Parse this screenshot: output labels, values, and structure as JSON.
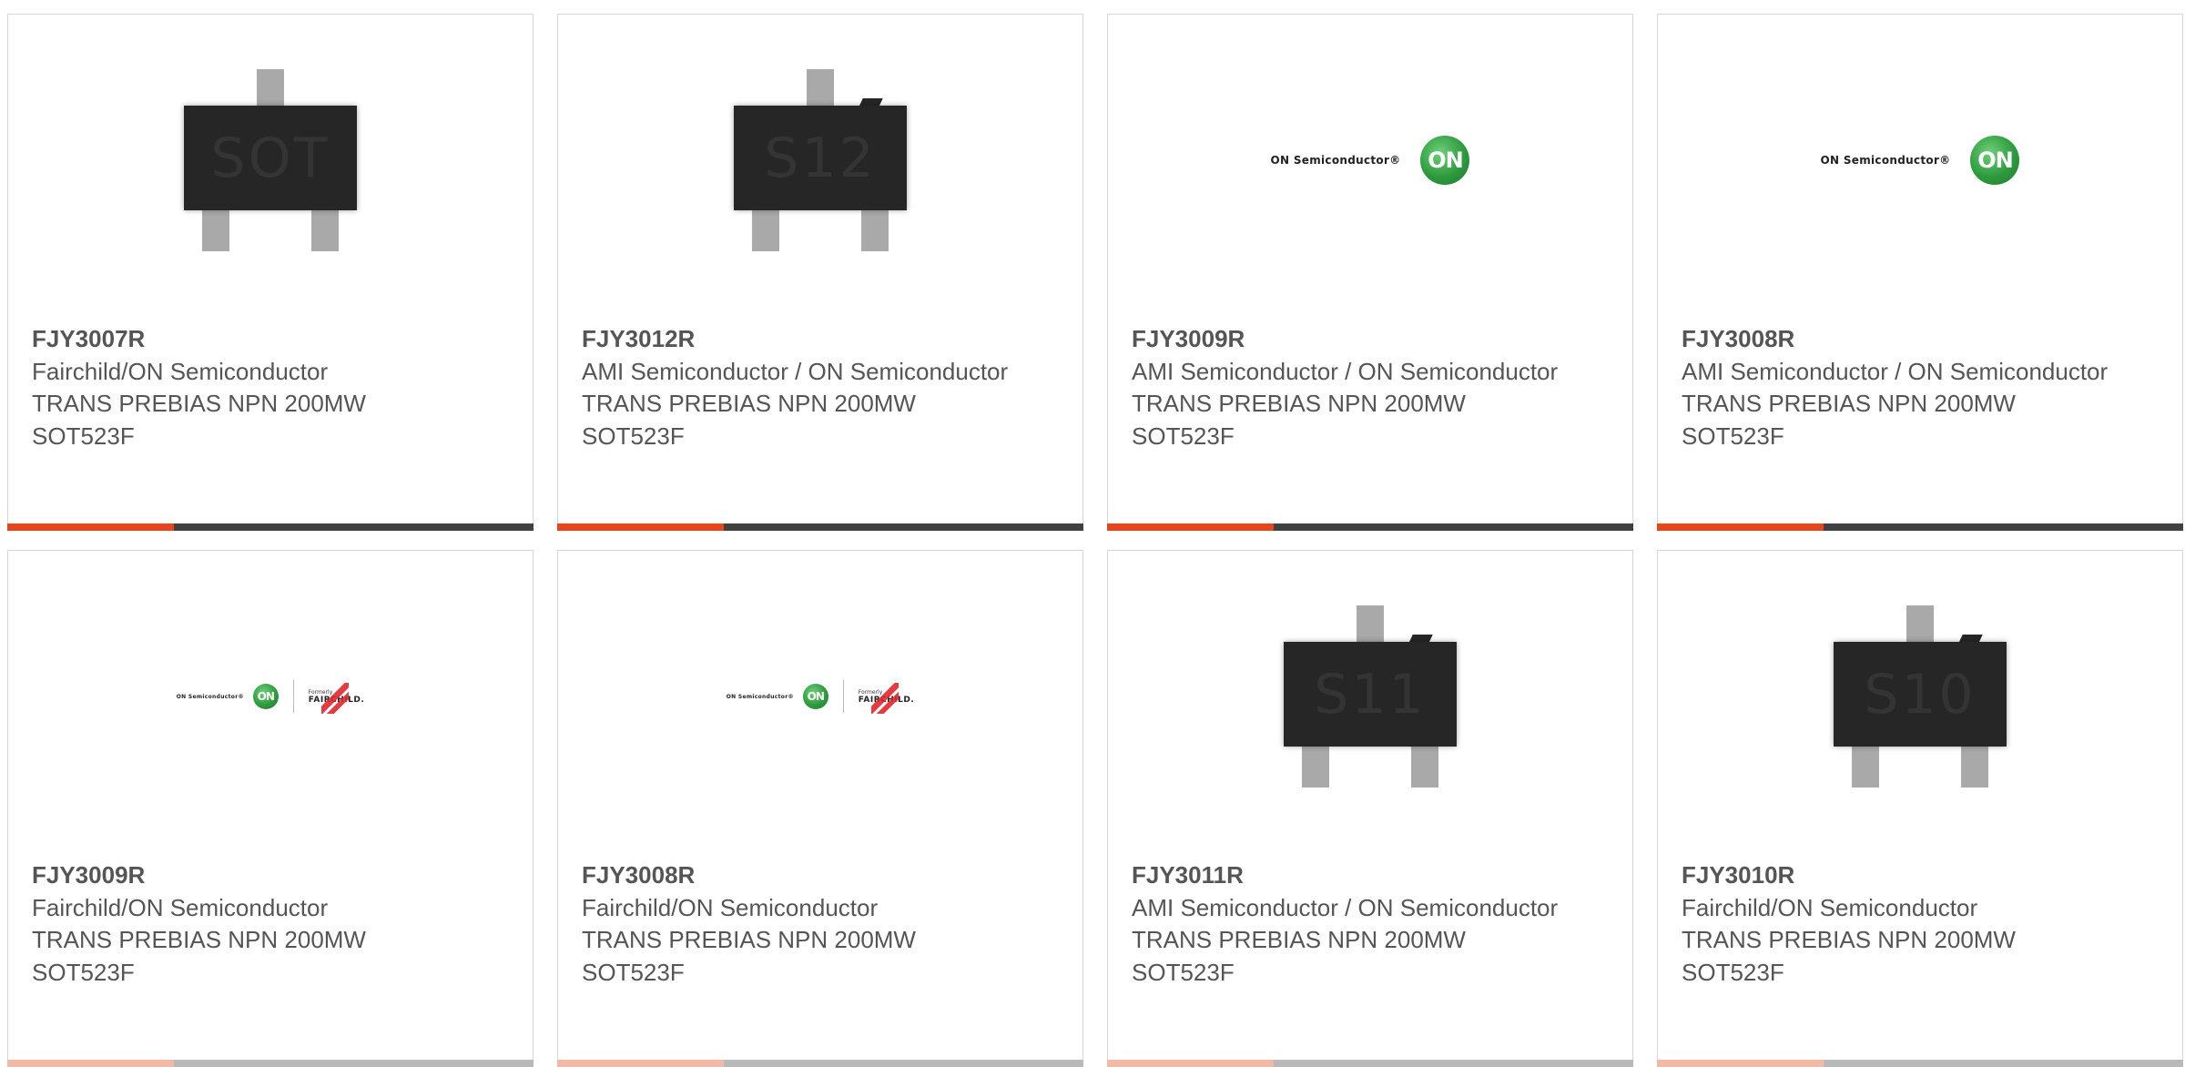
{
  "colors": {
    "accent_bar": "#e8451d",
    "dark_bar": "#404040",
    "accent_bar_faded": "#f1b9a6",
    "dark_bar_faded": "#b9b9b9"
  },
  "cards": [
    {
      "image_type": "chip",
      "chip_marking": "SOT",
      "part_number": "FJY3007R",
      "manufacturer": "Fairchild/ON Semiconductor",
      "description": "TRANS PREBIAS NPN 200MW SOT523F"
    },
    {
      "image_type": "chip",
      "chip_marking": "S12",
      "part_number": "FJY3012R",
      "manufacturer": "AMI Semiconductor / ON Semiconductor",
      "description": "TRANS PREBIAS NPN 200MW SOT523F"
    },
    {
      "image_type": "on-logo",
      "logo_text": "ON Semiconductor®",
      "logo_mark": "ON",
      "part_number": "FJY3009R",
      "manufacturer": "AMI Semiconductor / ON Semiconductor",
      "description": "TRANS PREBIAS NPN 200MW SOT523F"
    },
    {
      "image_type": "on-logo",
      "logo_text": "ON Semiconductor®",
      "logo_mark": "ON",
      "part_number": "FJY3008R",
      "manufacturer": "AMI Semiconductor / ON Semiconductor",
      "description": "TRANS PREBIAS NPN 200MW SOT523F"
    },
    {
      "image_type": "combo-logo",
      "logo_text": "ON Semiconductor®",
      "logo_mark": "ON",
      "formerly_text": "Formerly",
      "fairchild_text": "FAIRCHILD.",
      "part_number": "FJY3009R",
      "manufacturer": "Fairchild/ON Semiconductor",
      "description": "TRANS PREBIAS NPN 200MW SOT523F"
    },
    {
      "image_type": "combo-logo",
      "logo_text": "ON Semiconductor®",
      "logo_mark": "ON",
      "formerly_text": "Formerly",
      "fairchild_text": "FAIRCHILD.",
      "part_number": "FJY3008R",
      "manufacturer": "Fairchild/ON Semiconductor",
      "description": "TRANS PREBIAS NPN 200MW SOT523F"
    },
    {
      "image_type": "chip",
      "chip_marking": "S11",
      "part_number": "FJY3011R",
      "manufacturer": "AMI Semiconductor / ON Semiconductor",
      "description": "TRANS PREBIAS NPN 200MW SOT523F"
    },
    {
      "image_type": "chip",
      "chip_marking": "S10",
      "part_number": "FJY3010R",
      "manufacturer": "Fairchild/ON Semiconductor",
      "description": "TRANS PREBIAS NPN 200MW SOT523F"
    }
  ]
}
